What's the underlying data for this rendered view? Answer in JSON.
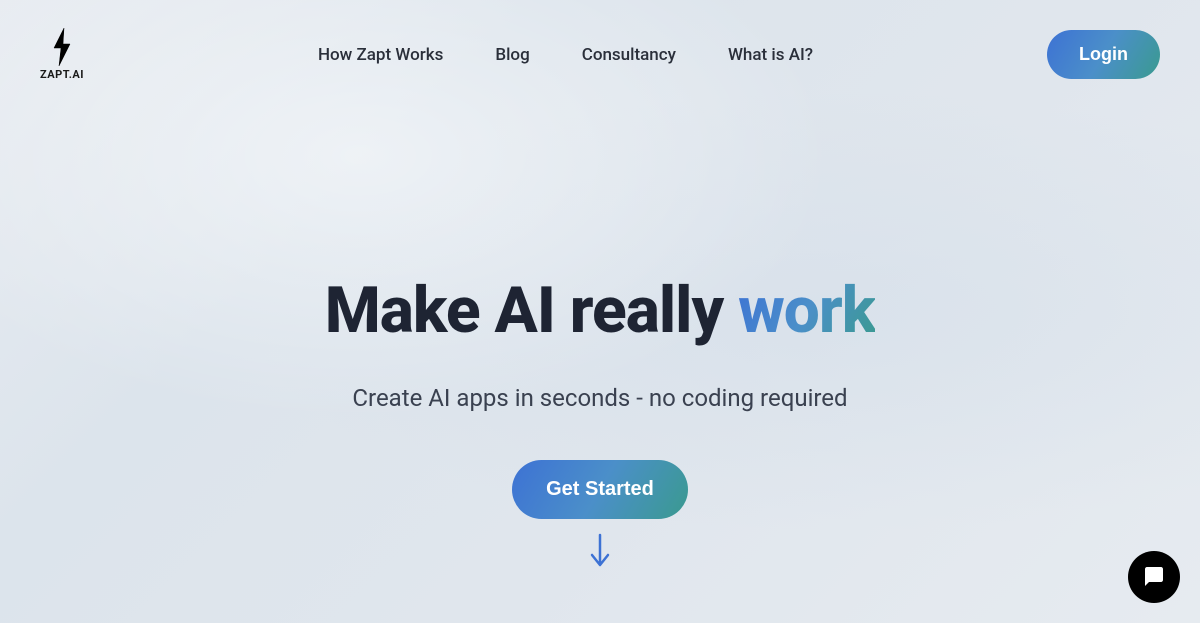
{
  "logo": {
    "text": "ZAPT.AI"
  },
  "nav": {
    "items": [
      "How Zapt Works",
      "Blog",
      "Consultancy",
      "What is AI?"
    ]
  },
  "login": {
    "label": "Login"
  },
  "hero": {
    "title_prefix": "Make AI really ",
    "title_accent": "work",
    "subtitle": "Create AI apps in seconds - no coding required",
    "cta_label": "Get Started"
  }
}
